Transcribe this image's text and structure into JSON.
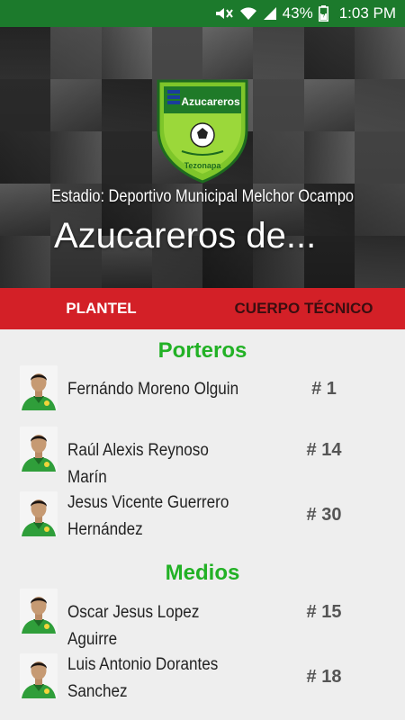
{
  "status_bar": {
    "battery": "43%",
    "time": "1:03 PM"
  },
  "header": {
    "crest_text": "Azucareros",
    "crest_subtext": "Tezonapa",
    "stadium": "Estadio: Deportivo Municipal Melchor Ocampo",
    "team_title": "Azucareros de..."
  },
  "tabs": [
    {
      "label": "PLANTEL",
      "active": true
    },
    {
      "label": "CUERPO TÉCNICO",
      "active": false
    }
  ],
  "sections": [
    {
      "title": "Porteros",
      "players": [
        {
          "name": "Fernándo Moreno Olguin",
          "number": "# 1"
        },
        {
          "name": "Raúl Alexis Reynoso Marín",
          "number": "# 14"
        },
        {
          "name": "Jesus Vicente Guerrero Hernández",
          "number": "# 30"
        }
      ]
    },
    {
      "title": "Medios",
      "players": [
        {
          "name": "Oscar Jesus Lopez Aguirre",
          "number": "# 15"
        },
        {
          "name": "Luis Antonio Dorantes Sanchez",
          "number": "# 18"
        }
      ]
    }
  ],
  "colors": {
    "status_bar": "#1c7a2c",
    "tab_bar": "#d32027",
    "section_title": "#22b125",
    "jersey": "#2f9e3a",
    "background": "#eeeeee"
  }
}
